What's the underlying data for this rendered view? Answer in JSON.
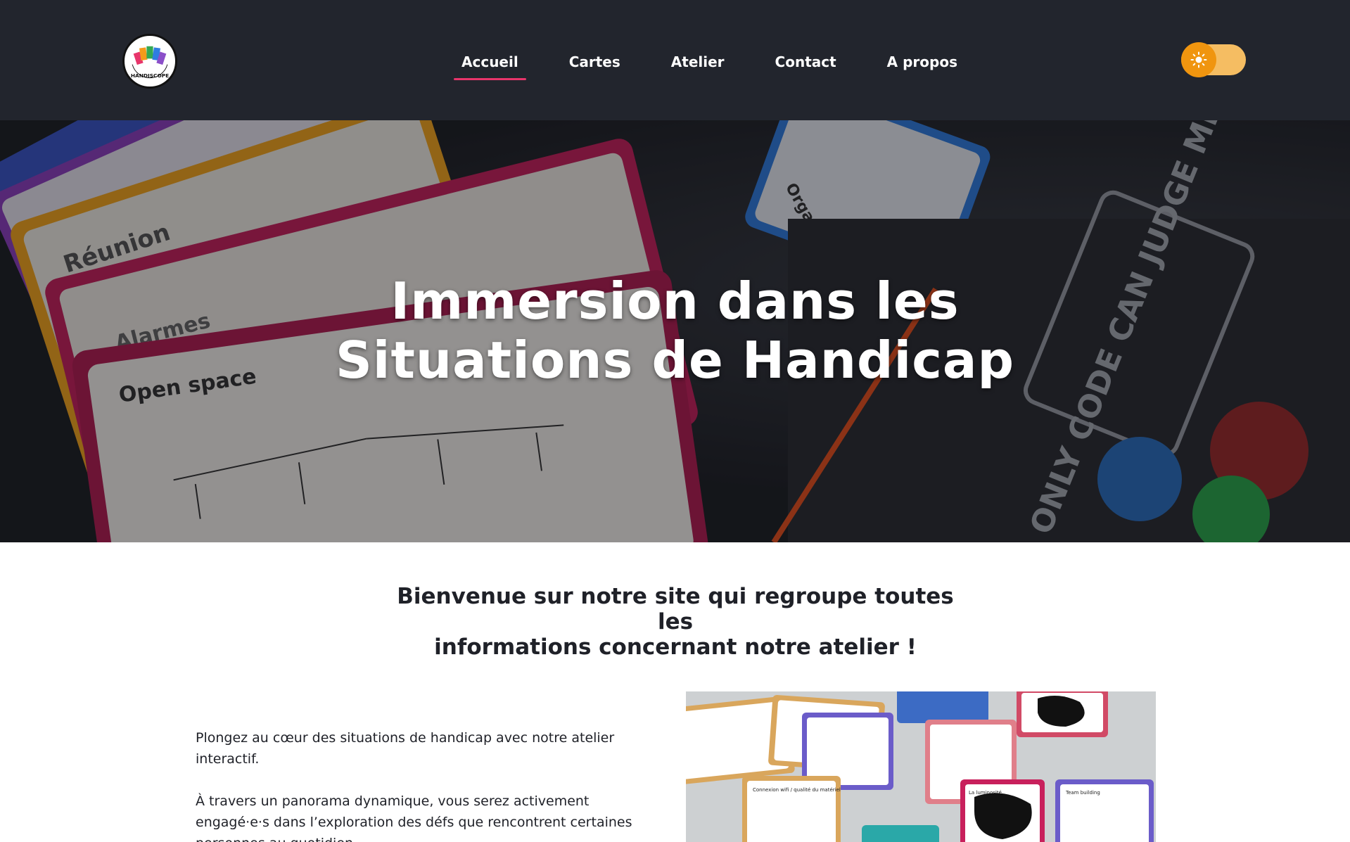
{
  "logo": {
    "text": "HANDISCOPE",
    "icon": "handiscope-logo-icon"
  },
  "nav": {
    "items": [
      {
        "label": "Accueil",
        "active": true
      },
      {
        "label": "Cartes",
        "active": false
      },
      {
        "label": "Atelier",
        "active": false
      },
      {
        "label": "Contact",
        "active": false
      },
      {
        "label": "A propos",
        "active": false
      }
    ]
  },
  "theme_toggle": {
    "icon": "sun-icon",
    "state": "light"
  },
  "hero": {
    "title_line1": "Immersion dans les",
    "title_line2": "Situations de Handicap",
    "card_labels": [
      "Open space",
      "Alarmes",
      "Réunion",
      "Organisation de la journée"
    ],
    "sticker_text": "ONLY CODE CAN JUDGE ME"
  },
  "intro": {
    "heading_line1": "Bienvenue sur notre site qui regroupe toutes les",
    "heading_line2": "informations concernant notre atelier !",
    "paragraph1": "Plongez au cœur des situations de handicap avec notre atelier interactif.",
    "paragraph2": "À travers un panorama dynamique, vous serez activement engagé·e·s dans l’exploration des défs que rencontrent certaines personnes au quotidien.",
    "photo_labels": [
      "Connexion wifi / qualité du matériel",
      "La luminosité",
      "Team building"
    ]
  },
  "colors": {
    "header_bg": "#22252d",
    "accent_underline": "#e8356b",
    "toggle_track": "#f5bd62",
    "toggle_knob": "#f0950f"
  }
}
